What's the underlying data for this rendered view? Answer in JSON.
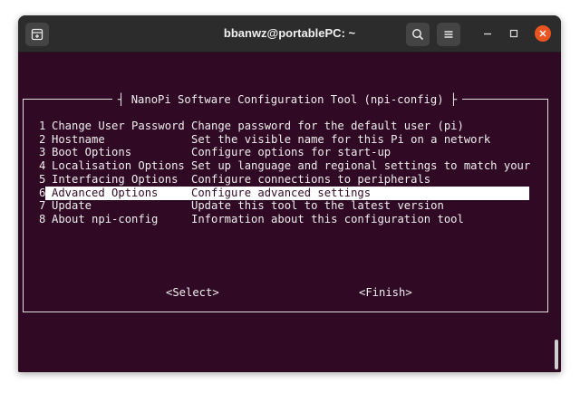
{
  "window": {
    "title": "bbanwz@portablePC: ~"
  },
  "titlebar": {
    "new_tab_icon": "terminal-tab-icon",
    "search_icon": "search-icon",
    "menu_icon": "hamburger-menu-icon",
    "minimize": "–",
    "maximize": "□",
    "close": "×"
  },
  "dialog": {
    "title": "NanoPi Software Configuration Tool (npi-config)",
    "items": [
      {
        "num": "1",
        "name": "Change User Password",
        "desc": "Change password for the default user (pi)"
      },
      {
        "num": "2",
        "name": "Hostname",
        "desc": "Set the visible name for this Pi on a network"
      },
      {
        "num": "3",
        "name": "Boot Options",
        "desc": "Configure options for start-up"
      },
      {
        "num": "4",
        "name": "Localisation Options",
        "desc": "Set up language and regional settings to match your"
      },
      {
        "num": "5",
        "name": "Interfacing Options",
        "desc": "Configure connections to peripherals"
      },
      {
        "num": "6",
        "name": "Advanced Options",
        "desc": "Configure advanced settings"
      },
      {
        "num": "7",
        "name": "Update",
        "desc": "Update this tool to the latest version"
      },
      {
        "num": "8",
        "name": "About npi-config",
        "desc": "Information about this configuration tool"
      }
    ],
    "selected_index": 5,
    "select_button": "<Select>",
    "finish_button": "<Finish>"
  },
  "colors": {
    "terminal_bg": "#300a24",
    "close_button": "#e95420",
    "titlebar": "#2c2c2c"
  }
}
